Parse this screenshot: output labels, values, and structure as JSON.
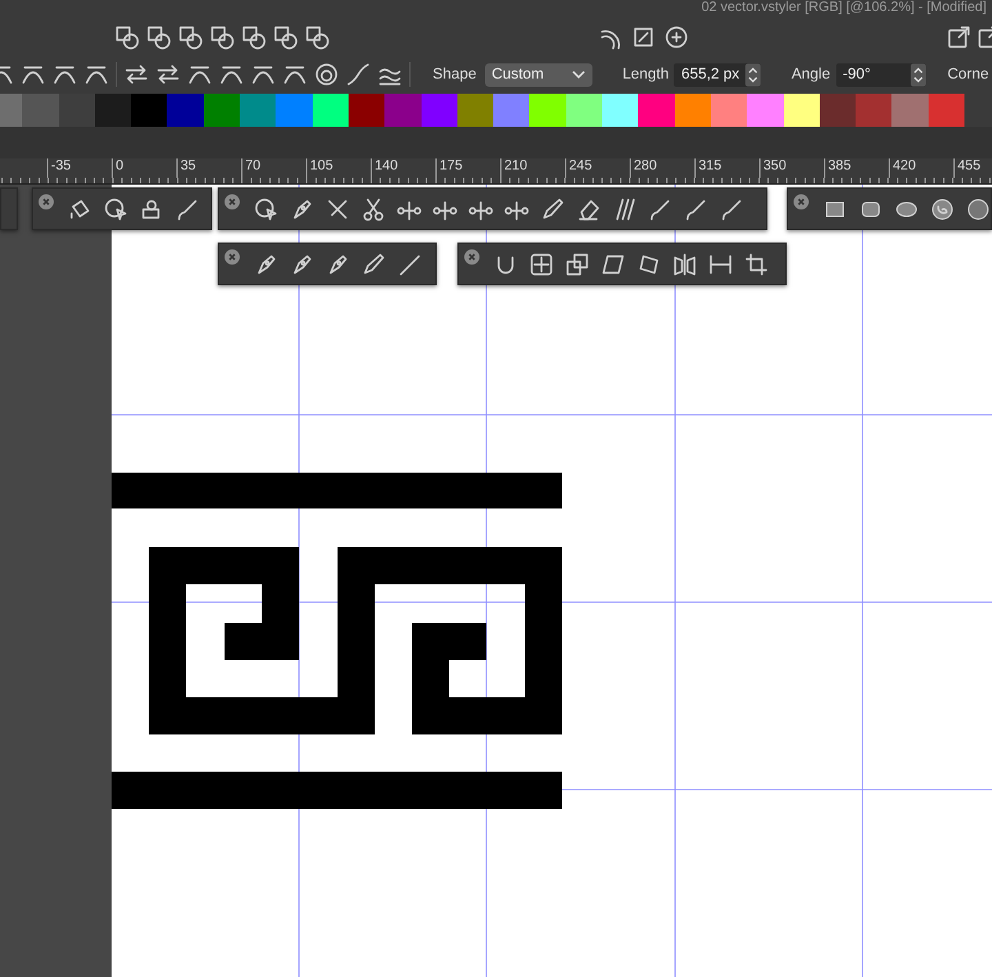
{
  "window": {
    "title": "02 vector.vstyler [RGB] [@106.2%] - [Modified]"
  },
  "context_bar": {
    "shape_label": "Shape",
    "shape_value": "Custom",
    "length_label": "Length",
    "length_value": "655,2 px",
    "angle_label": "Angle",
    "angle_value": "-90°",
    "corner_label": "Corne"
  },
  "palette": [
    {
      "color": "#6e6e6e"
    },
    {
      "color": "#555555"
    },
    {
      "color": "#3e3e3e"
    },
    {
      "color": "#1c1c1c"
    },
    {
      "color": "#000000"
    },
    {
      "color": "#000099"
    },
    {
      "color": "#008000"
    },
    {
      "color": "#008b8b"
    },
    {
      "color": "#0080ff"
    },
    {
      "color": "#00ff80"
    },
    {
      "color": "#8b0000"
    },
    {
      "color": "#8b008b"
    },
    {
      "color": "#8000ff"
    },
    {
      "color": "#808000"
    },
    {
      "color": "#8080ff"
    },
    {
      "color": "#80ff00"
    },
    {
      "color": "#80ff80"
    },
    {
      "color": "#80ffff"
    },
    {
      "color": "#ff0080"
    },
    {
      "color": "#ff8000"
    },
    {
      "color": "#ff8080"
    },
    {
      "color": "#ff80ff"
    },
    {
      "color": "#ffff80"
    },
    {
      "color": "#6b2c2c"
    },
    {
      "color": "#a33030"
    },
    {
      "color": "#a07070"
    },
    {
      "color": "#d83030"
    }
  ],
  "ruler": {
    "labels": [
      "-35",
      "0",
      "35",
      "70",
      "105",
      "140",
      "175",
      "210",
      "245",
      "280",
      "315",
      "350",
      "385",
      "420",
      "455"
    ]
  }
}
